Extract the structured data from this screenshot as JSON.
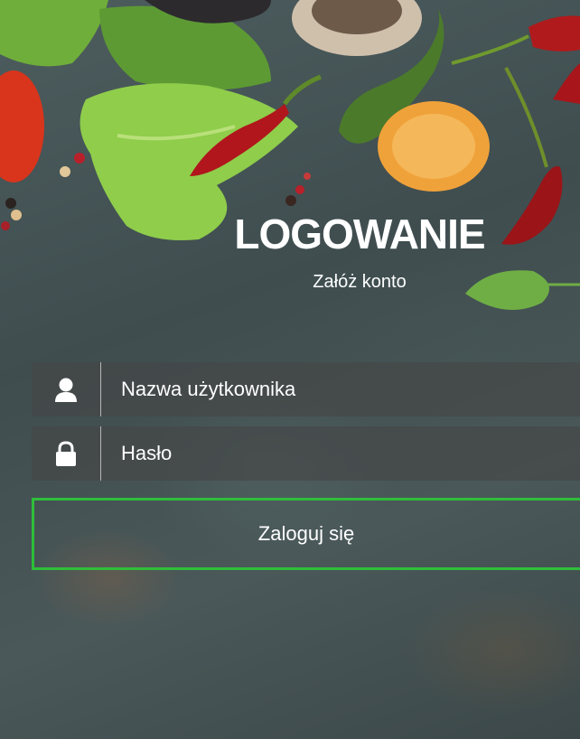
{
  "header": {
    "title": "LOGOWANIE",
    "register_link": "Załóż konto"
  },
  "form": {
    "username": {
      "placeholder": "Nazwa użytkownika",
      "value": "",
      "icon": "user-icon"
    },
    "password": {
      "placeholder": "Hasło",
      "value": "",
      "icon": "lock-icon"
    },
    "submit_label": "Zaloguj się"
  },
  "colors": {
    "button_border": "#2fbe3a",
    "text": "#ffffff"
  }
}
